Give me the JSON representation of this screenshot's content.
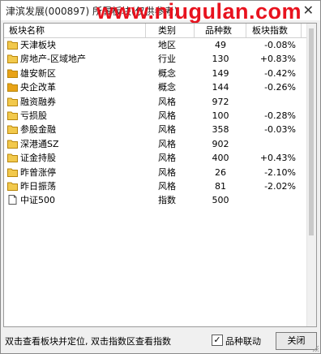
{
  "window": {
    "title": "津滨发展(000897) 所属板块(仅供参考)",
    "watermark": "www.niugulan.com",
    "close_glyph": "✕"
  },
  "columns": [
    "板块名称",
    "类别",
    "品种数",
    "板块指数"
  ],
  "rows": [
    {
      "icon": "folder-icon",
      "name": "天津板块",
      "category": "地区",
      "count": "49",
      "index": "-0.08%"
    },
    {
      "icon": "folder-icon",
      "name": "房地产-区域地产",
      "category": "行业",
      "count": "130",
      "index": "+0.83%"
    },
    {
      "icon": "folder-icon-filled",
      "name": "雄安新区",
      "category": "概念",
      "count": "149",
      "index": "-0.42%"
    },
    {
      "icon": "folder-icon-filled",
      "name": "央企改革",
      "category": "概念",
      "count": "144",
      "index": "-0.26%"
    },
    {
      "icon": "folder-icon",
      "name": "融资融券",
      "category": "风格",
      "count": "972",
      "index": ""
    },
    {
      "icon": "folder-icon",
      "name": "亏损股",
      "category": "风格",
      "count": "100",
      "index": "-0.28%"
    },
    {
      "icon": "folder-icon",
      "name": "参股金融",
      "category": "风格",
      "count": "358",
      "index": "-0.03%"
    },
    {
      "icon": "folder-icon",
      "name": "深港通SZ",
      "category": "风格",
      "count": "902",
      "index": ""
    },
    {
      "icon": "folder-icon",
      "name": "证金持股",
      "category": "风格",
      "count": "400",
      "index": "+0.43%"
    },
    {
      "icon": "folder-icon",
      "name": "昨曾涨停",
      "category": "风格",
      "count": "26",
      "index": "-2.10%"
    },
    {
      "icon": "folder-icon",
      "name": "昨日振荡",
      "category": "风格",
      "count": "81",
      "index": "-2.02%"
    },
    {
      "icon": "document-icon",
      "name": "中证500",
      "category": "指数",
      "count": "500",
      "index": ""
    }
  ],
  "status": {
    "hint": "双击查看板块并定位, 双击指数区查看指数",
    "checkbox_label": "品种联动",
    "checkbox_checked": true,
    "check_glyph": "✓",
    "close_button": "关闭"
  },
  "colors": {
    "folder": "#f2c94c",
    "folder_filled": "#e8a317",
    "folder_outline": "#b8860b",
    "watermark": "#e8121e"
  }
}
